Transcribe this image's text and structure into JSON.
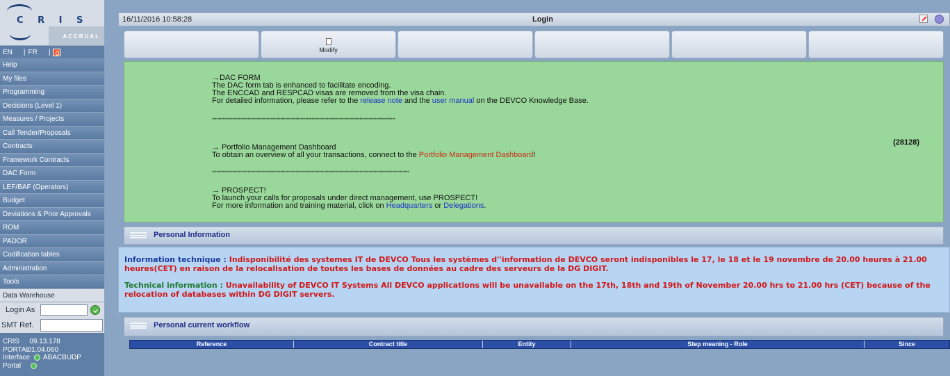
{
  "sidebar": {
    "logo": {
      "title": "C R I S",
      "subtitle": "ACCRUAL"
    },
    "lang": {
      "en": "EN",
      "fr": "FR",
      "sep": "|"
    },
    "menu": [
      "Help",
      "My files",
      "Programming",
      "Decisions (Level 1)",
      "Measures / Projects",
      "Call Tender/Proposals",
      "Contracts",
      "Framework Contracts",
      "DAC Form",
      "LEF/BAF (Operators)",
      "Budget",
      "Deviations & Prior Approvals",
      "ROM",
      "PADOR",
      "Codification tables",
      "Administration",
      "Tools",
      "Data Warehouse"
    ],
    "login_as_label": "Login As",
    "login_as_value": "",
    "smt_label": "SMT Ref.",
    "smt_value": "",
    "info": {
      "cris_label": "CRIS",
      "cris_version": "09.13.178",
      "portal_label": "PORTAL",
      "portal_version": "01.04.060",
      "interface_label": "Interface",
      "interface_value": "ABACBUDP",
      "portal2_label": "Portal"
    }
  },
  "topbar": {
    "date": "16/11/2016 10:58:28",
    "title": "Login"
  },
  "toolbar": {
    "modify": "Modify"
  },
  "notice": {
    "dac_title": "→DAC FORM",
    "dac_l1": "The DAC form tab is enhanced to facilitate encoding.",
    "dac_l2": "The ENCCAD and RESPCAD visas are removed from the visa chain.",
    "dac_l3_a": "For detailed information, please refer to the ",
    "dac_l3_link1": "release note",
    "dac_l3_b": " and the ",
    "dac_l3_link2": "user manual",
    "dac_l3_c": " on the DEVCO Knowledge Base.",
    "stars1": "**********************************************************************************************************************",
    "pmd_title": "→ Portfolio Management Dashboard",
    "pmd_a": "To obtain an overview of all your transactions, connect to the ",
    "pmd_link": "Portfolio Management Dashboard",
    "pmd_b": "!",
    "stars2": "*******************************************************************************************************************************",
    "prospect_title": "→ PROSPECT!",
    "prospect_l1": "To launch your calls for proposals under direct management, use PROSPECT!",
    "prospect_a": "For more information and training material, click on ",
    "prospect_link1": "Headquarters",
    "prospect_b": " or ",
    "prospect_link2": "Delegations",
    "prospect_c": ".",
    "counter": "(28128)"
  },
  "personal_info": {
    "title": "Personal Information"
  },
  "tech_notice": {
    "fr_label": "Information technique :",
    "fr_text": " Indisponibilité des systemes IT de DEVCO Tous les systèmes d''information de DEVCO seront indisponibles le 17, le 18 et le 19 novembre de 20.00 heures à 21.00 heures(CET) en raison de la relocalisation de toutes les bases de données au cadre des serveurs de la DG DIGIT.",
    "en_label": "Technical information :",
    "en_text": " Unavailability of DEVCO IT Systems All DEVCO applications will be unavailable on the 17th, 18th and 19th of November 20.00 hrs to 21.00 hrs (CET) because of the relocation of databases within DG DIGIT servers."
  },
  "workflow": {
    "title": "Personal current workflow",
    "columns": [
      "Reference",
      "Contract title",
      "Entity",
      "Step meaning - Role",
      "Since"
    ]
  }
}
